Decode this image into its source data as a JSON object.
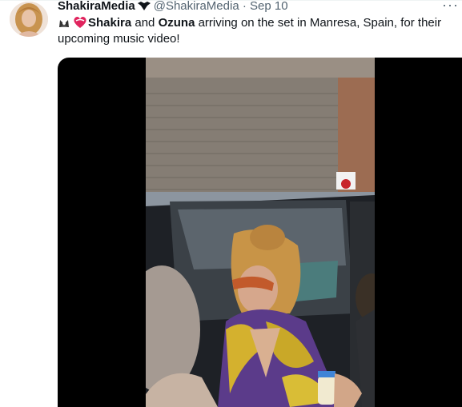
{
  "tweet": {
    "display_name": "ShakiraMedia",
    "handle": "@ShakiraMedia",
    "separator": "·",
    "date": "Sep 10",
    "more_label": "···",
    "text": {
      "bold1": "Shakira",
      "mid": " and ",
      "bold2": "Ozuna",
      "rest": " arriving on the set in Manresa, Spain, for their upcoming music video!"
    }
  },
  "colors": {
    "text_primary": "#0f1419",
    "text_secondary": "#536471",
    "media_background": "#000000",
    "heart": "#e0245e"
  },
  "icons": [
    "avatar",
    "verified-badge-icon",
    "fox-emoji-icon",
    "heart-emoji-icon",
    "more-options-icon"
  ]
}
